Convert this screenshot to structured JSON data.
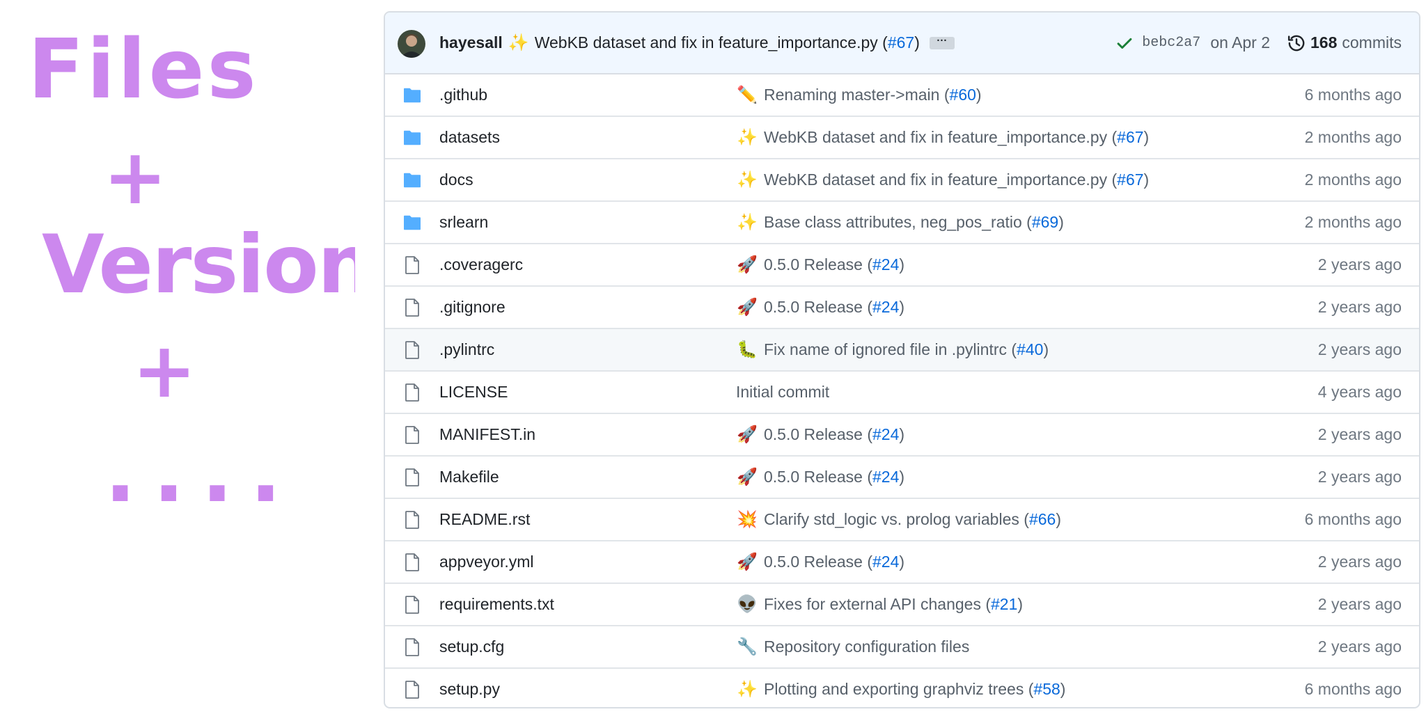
{
  "annotation": {
    "line1": "Files",
    "plus1": "+",
    "line2": "Versions",
    "plus2": "+",
    "line3": "...."
  },
  "latest_commit": {
    "author": "hayesall",
    "emoji": "✨",
    "message": "WebKB dataset and fix in feature_importance.py",
    "pr": "#67",
    "ellipsis": "···",
    "sha": "bebc2a7",
    "date": "on Apr 2",
    "commit_count": "168",
    "commits_label": "commits",
    "status_icon": "check-icon",
    "status_color": "#1a7f37"
  },
  "colors": {
    "folder": "#54aeff",
    "link": "#0969da",
    "file_icon": "#6e7781"
  },
  "files": [
    {
      "type": "folder",
      "name": ".github",
      "emoji": "✏️",
      "message": "Renaming master->main",
      "pr": "#60",
      "age": "6 months ago"
    },
    {
      "type": "folder",
      "name": "datasets",
      "emoji": "✨",
      "message": "WebKB dataset and fix in feature_importance.py",
      "pr": "#67",
      "age": "2 months ago"
    },
    {
      "type": "folder",
      "name": "docs",
      "emoji": "✨",
      "message": "WebKB dataset and fix in feature_importance.py",
      "pr": "#67",
      "age": "2 months ago"
    },
    {
      "type": "folder",
      "name": "srlearn",
      "emoji": "✨",
      "message": "Base class attributes, neg_pos_ratio",
      "pr": "#69",
      "age": "2 months ago"
    },
    {
      "type": "file",
      "name": ".coveragerc",
      "emoji": "🚀",
      "message": "0.5.0 Release",
      "pr": "#24",
      "age": "2 years ago"
    },
    {
      "type": "file",
      "name": ".gitignore",
      "emoji": "🚀",
      "message": "0.5.0 Release",
      "pr": "#24",
      "age": "2 years ago"
    },
    {
      "type": "file",
      "name": ".pylintrc",
      "emoji": "🐛",
      "message": "Fix name of ignored file in .pylintrc",
      "pr": "#40",
      "age": "2 years ago",
      "highlighted": true
    },
    {
      "type": "file",
      "name": "LICENSE",
      "emoji": "",
      "message": "Initial commit",
      "pr": "",
      "age": "4 years ago"
    },
    {
      "type": "file",
      "name": "MANIFEST.in",
      "emoji": "🚀",
      "message": "0.5.0 Release",
      "pr": "#24",
      "age": "2 years ago"
    },
    {
      "type": "file",
      "name": "Makefile",
      "emoji": "🚀",
      "message": "0.5.0 Release",
      "pr": "#24",
      "age": "2 years ago"
    },
    {
      "type": "file",
      "name": "README.rst",
      "emoji": "💥",
      "message": "Clarify std_logic vs. prolog variables",
      "pr": "#66",
      "age": "6 months ago"
    },
    {
      "type": "file",
      "name": "appveyor.yml",
      "emoji": "🚀",
      "message": "0.5.0 Release",
      "pr": "#24",
      "age": "2 years ago"
    },
    {
      "type": "file",
      "name": "requirements.txt",
      "emoji": "👽",
      "message": "Fixes for external API changes",
      "pr": "#21",
      "age": "2 years ago"
    },
    {
      "type": "file",
      "name": "setup.cfg",
      "emoji": "🔧",
      "message": "Repository configuration files",
      "pr": "",
      "age": "2 years ago"
    },
    {
      "type": "file",
      "name": "setup.py",
      "emoji": "✨",
      "message": "Plotting and exporting graphviz trees",
      "pr": "#58",
      "age": "6 months ago"
    }
  ]
}
